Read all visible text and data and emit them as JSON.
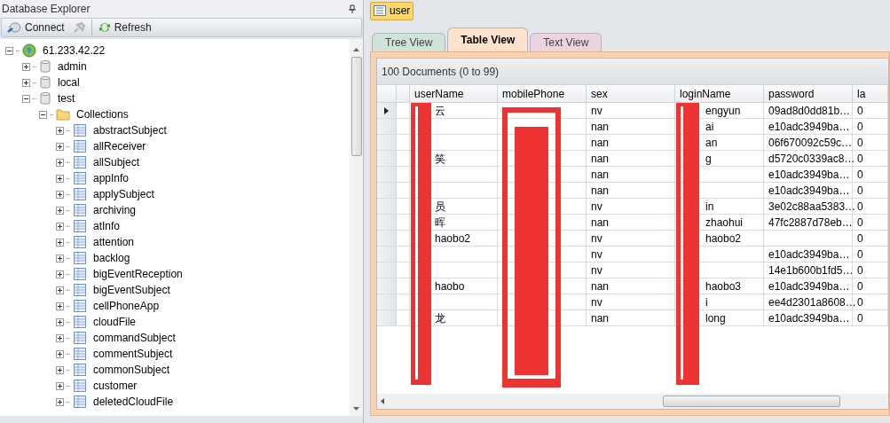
{
  "explorer": {
    "title": "Database Explorer",
    "toolbar": [
      "Connect",
      "Refresh"
    ],
    "tree": [
      {
        "label": "61.233.42.22",
        "kind": "server",
        "expanded": true,
        "children": [
          {
            "label": "admin",
            "kind": "database",
            "expanded": false
          },
          {
            "label": "local",
            "kind": "database",
            "expanded": false
          },
          {
            "label": "test",
            "kind": "database",
            "expanded": true,
            "children": [
              {
                "label": "Collections",
                "kind": "folder",
                "expanded": true,
                "children": [
                  {
                    "label": "abstractSubject",
                    "kind": "collection",
                    "expanded": false
                  },
                  {
                    "label": "allReceiver",
                    "kind": "collection",
                    "expanded": false
                  },
                  {
                    "label": "allSubject",
                    "kind": "collection",
                    "expanded": false
                  },
                  {
                    "label": "appInfo",
                    "kind": "collection",
                    "expanded": false
                  },
                  {
                    "label": "applySubject",
                    "kind": "collection",
                    "expanded": false
                  },
                  {
                    "label": "archiving",
                    "kind": "collection",
                    "expanded": false
                  },
                  {
                    "label": "atInfo",
                    "kind": "collection",
                    "expanded": false
                  },
                  {
                    "label": "attention",
                    "kind": "collection",
                    "expanded": false
                  },
                  {
                    "label": "backlog",
                    "kind": "collection",
                    "expanded": false
                  },
                  {
                    "label": "bigEventReception",
                    "kind": "collection",
                    "expanded": false
                  },
                  {
                    "label": "bigEventSubject",
                    "kind": "collection",
                    "expanded": false
                  },
                  {
                    "label": "cellPhoneApp",
                    "kind": "collection",
                    "expanded": false
                  },
                  {
                    "label": "cloudFile",
                    "kind": "collection",
                    "expanded": false
                  },
                  {
                    "label": "commandSubject",
                    "kind": "collection",
                    "expanded": false
                  },
                  {
                    "label": "commentSubject",
                    "kind": "collection",
                    "expanded": false
                  },
                  {
                    "label": "commonSubject",
                    "kind": "collection",
                    "expanded": false
                  },
                  {
                    "label": "customer",
                    "kind": "collection",
                    "expanded": false
                  },
                  {
                    "label": "deletedCloudFile",
                    "kind": "collection",
                    "expanded": false
                  }
                ]
              }
            ]
          }
        ]
      }
    ]
  },
  "document_tab": {
    "label": "user"
  },
  "view_tabs": [
    {
      "label": "Tree View",
      "selected": false
    },
    {
      "label": "Table View",
      "selected": true
    },
    {
      "label": "Text View",
      "selected": false
    }
  ],
  "table": {
    "summary": "100 Documents (0 to 99)",
    "columns": [
      "userName",
      "mobilePhone",
      "sex",
      "loginName",
      "password",
      "la"
    ],
    "rows": [
      {
        "current": true,
        "cells": [
          "云",
          "",
          "nv",
          "engyun",
          "09ad8d0dd81b…",
          "0"
        ]
      },
      {
        "current": false,
        "cells": [
          "",
          "",
          "nan",
          "ai",
          "e10adc3949ba…",
          "0"
        ]
      },
      {
        "current": false,
        "cells": [
          "",
          "",
          "nan",
          "an",
          "06f670092c59c…",
          "0"
        ]
      },
      {
        "current": false,
        "cells": [
          "笑",
          "",
          "nan",
          "g",
          "d5720c0339ac8…",
          "0"
        ]
      },
      {
        "current": false,
        "cells": [
          "",
          "",
          "nan",
          "",
          "e10adc3949ba…",
          "0"
        ]
      },
      {
        "current": false,
        "cells": [
          "",
          "",
          "nan",
          "",
          "e10adc3949ba…",
          "0"
        ]
      },
      {
        "current": false,
        "cells": [
          "员",
          "",
          "nv",
          "in",
          "3e02c88aa5383…",
          "0"
        ]
      },
      {
        "current": false,
        "cells": [
          "晖",
          "",
          "nan",
          "zhaohui",
          "47fc2887d78eb…",
          "0"
        ]
      },
      {
        "current": false,
        "cells": [
          "haobo2",
          "",
          "nv",
          "haobo2",
          "",
          "0"
        ]
      },
      {
        "current": false,
        "cells": [
          "",
          "",
          "nv",
          "",
          "e10adc3949ba…",
          "0"
        ]
      },
      {
        "current": false,
        "cells": [
          "",
          "",
          "nv",
          "",
          "14e1b600b1fd5…",
          "0"
        ]
      },
      {
        "current": false,
        "cells": [
          "haobo",
          "",
          "nan",
          "haobo3",
          "e10adc3949ba…",
          "0"
        ]
      },
      {
        "current": false,
        "cells": [
          "",
          "",
          "nv",
          "i",
          "ee4d2301a8608…",
          "0"
        ]
      },
      {
        "current": false,
        "cells": [
          "龙",
          "",
          "nan",
          "long",
          "e10adc3949ba…",
          "0"
        ]
      }
    ]
  }
}
